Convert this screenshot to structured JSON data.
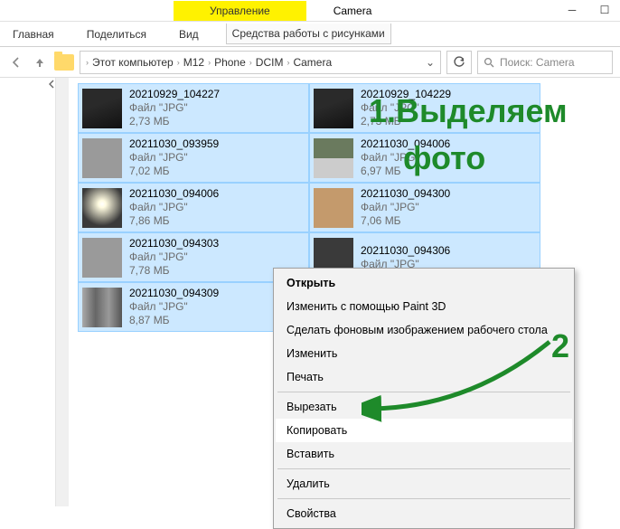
{
  "window": {
    "manage_tab": "Управление",
    "title": "Camera",
    "tabs": {
      "file": "Главная",
      "share": "Поделиться",
      "view": "Вид",
      "tools": "Средства работы с рисунками"
    }
  },
  "breadcrumb": {
    "items": [
      "Этот компьютер",
      "M12",
      "Phone",
      "DCIM",
      "Camera"
    ]
  },
  "search": {
    "placeholder": "Поиск: Camera"
  },
  "files": [
    {
      "name": "20210929_104227",
      "type": "Файл \"JPG\"",
      "size": "2,73 МБ",
      "thumb": "laptop",
      "selected": true
    },
    {
      "name": "20210929_104229",
      "type": "Файл \"JPG\"",
      "size": "2,73 МБ",
      "thumb": "laptop",
      "selected": true
    },
    {
      "name": "20211030_093959",
      "type": "Файл \"JPG\"",
      "size": "7,02 МБ",
      "thumb": "gray",
      "selected": true
    },
    {
      "name": "20211030_094006",
      "type": "Файл \"JPG\"",
      "size": "6,97 МБ",
      "thumb": "green",
      "selected": true
    },
    {
      "name": "20211030_094006",
      "type": "Файл \"JPG\"",
      "size": "7,86 МБ",
      "thumb": "flash",
      "selected": true
    },
    {
      "name": "20211030_094300",
      "type": "Файл \"JPG\"",
      "size": "7,06 МБ",
      "thumb": "box",
      "selected": true
    },
    {
      "name": "20211030_094303",
      "type": "Файл \"JPG\"",
      "size": "7,78 МБ",
      "thumb": "gray",
      "selected": true
    },
    {
      "name": "20211030_094306",
      "type": "Файл \"JPG\"",
      "size": "",
      "thumb": "dark",
      "selected": true
    },
    {
      "name": "20211030_094309",
      "type": "Файл \"JPG\"",
      "size": "8,87 МБ",
      "thumb": "books",
      "selected": true
    }
  ],
  "context_menu": {
    "open": "Открыть",
    "edit_paint3d": "Изменить с помощью Paint 3D",
    "set_wallpaper": "Сделать фоновым изображением рабочего стола",
    "edit": "Изменить",
    "print": "Печать",
    "cut": "Вырезать",
    "copy": "Копировать",
    "paste": "Вставить",
    "delete": "Удалить",
    "properties": "Свойства"
  },
  "annotations": {
    "step1a": "1.Выделяем",
    "step1b": "фото",
    "step2": "2"
  }
}
